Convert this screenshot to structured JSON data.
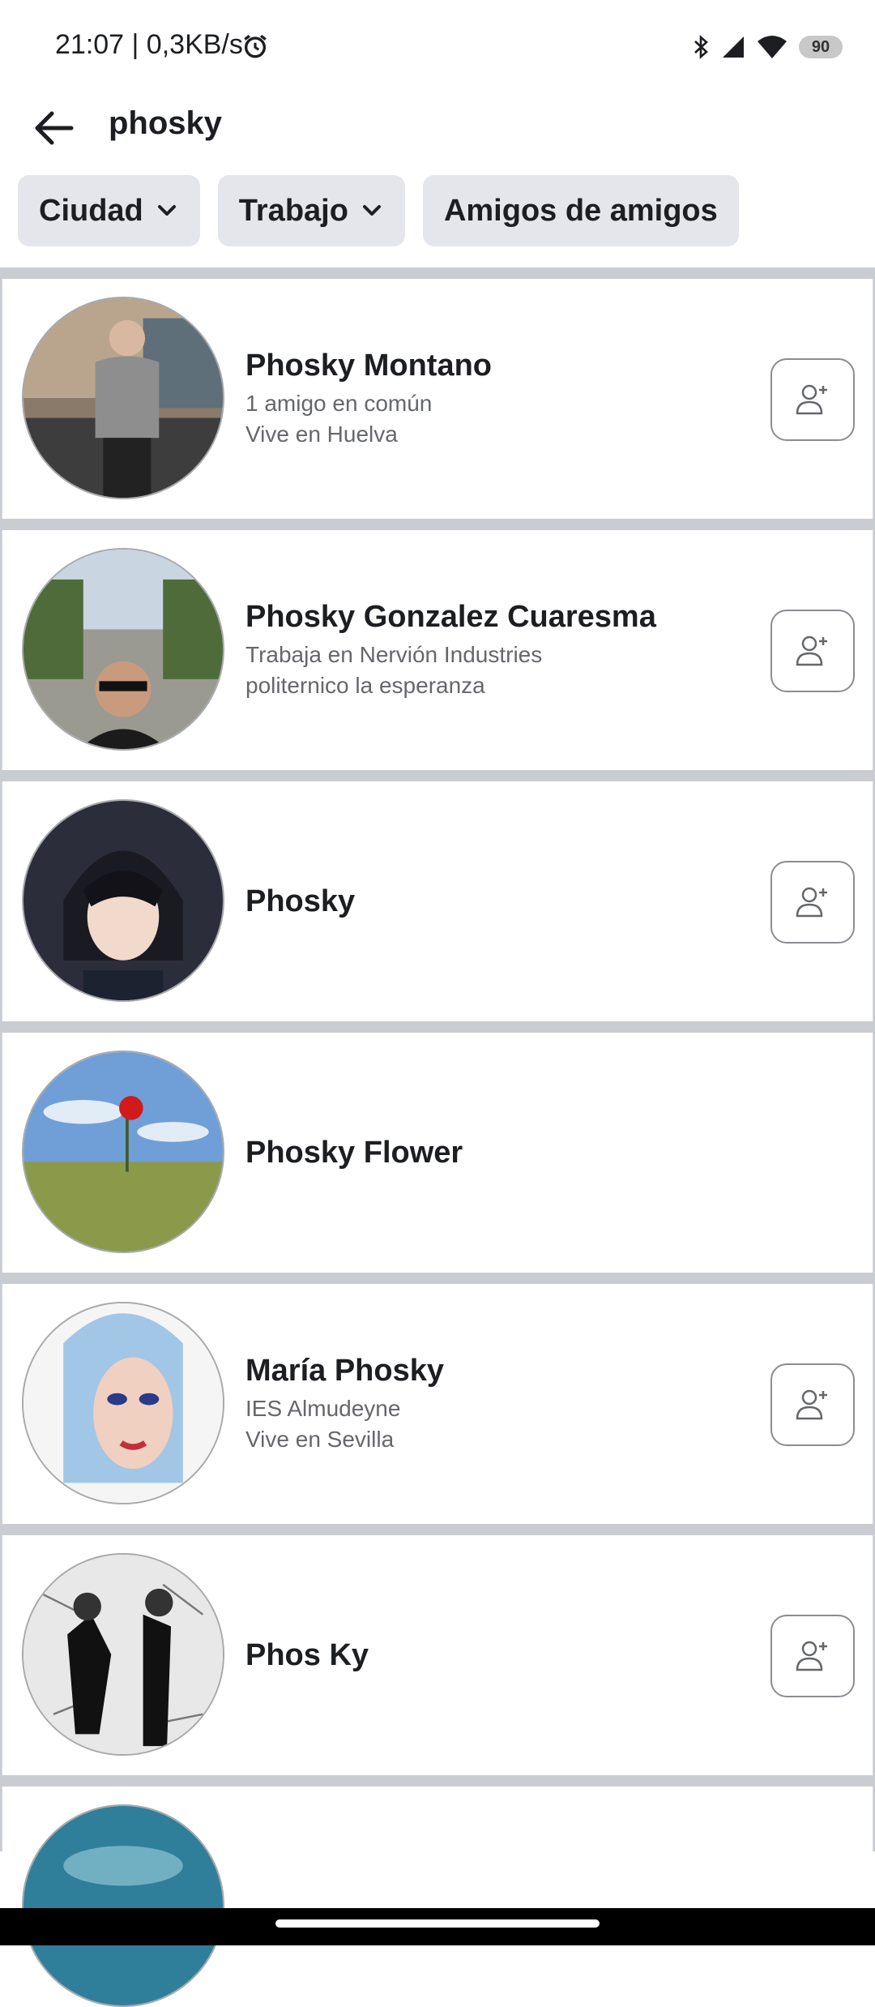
{
  "status_bar": {
    "time_text": "21:07 | 0,3KB/s",
    "battery": "90"
  },
  "search": {
    "query": "phosky"
  },
  "filters": [
    {
      "label": "Ciudad",
      "has_dropdown": true
    },
    {
      "label": "Trabajo",
      "has_dropdown": true
    },
    {
      "label": "Amigos de amigos",
      "has_dropdown": false
    }
  ],
  "results": [
    {
      "name": "Phosky Montano",
      "line1": "1 amigo en común",
      "line2": "Vive en Huelva",
      "add_button": true
    },
    {
      "name": "Phosky Gonzalez Cuaresma",
      "line1": "Trabaja en Nervión Industries",
      "line2": "politernico la esperanza",
      "add_button": true
    },
    {
      "name": "Phosky",
      "line1": "",
      "line2": "",
      "add_button": true
    },
    {
      "name": "Phosky Flower",
      "line1": "",
      "line2": "",
      "add_button": false
    },
    {
      "name": "María Phosky",
      "line1": "IES Almudeyne",
      "line2": "Vive en Sevilla",
      "add_button": true
    },
    {
      "name": "Phos Ky",
      "line1": "",
      "line2": "",
      "add_button": true
    }
  ]
}
